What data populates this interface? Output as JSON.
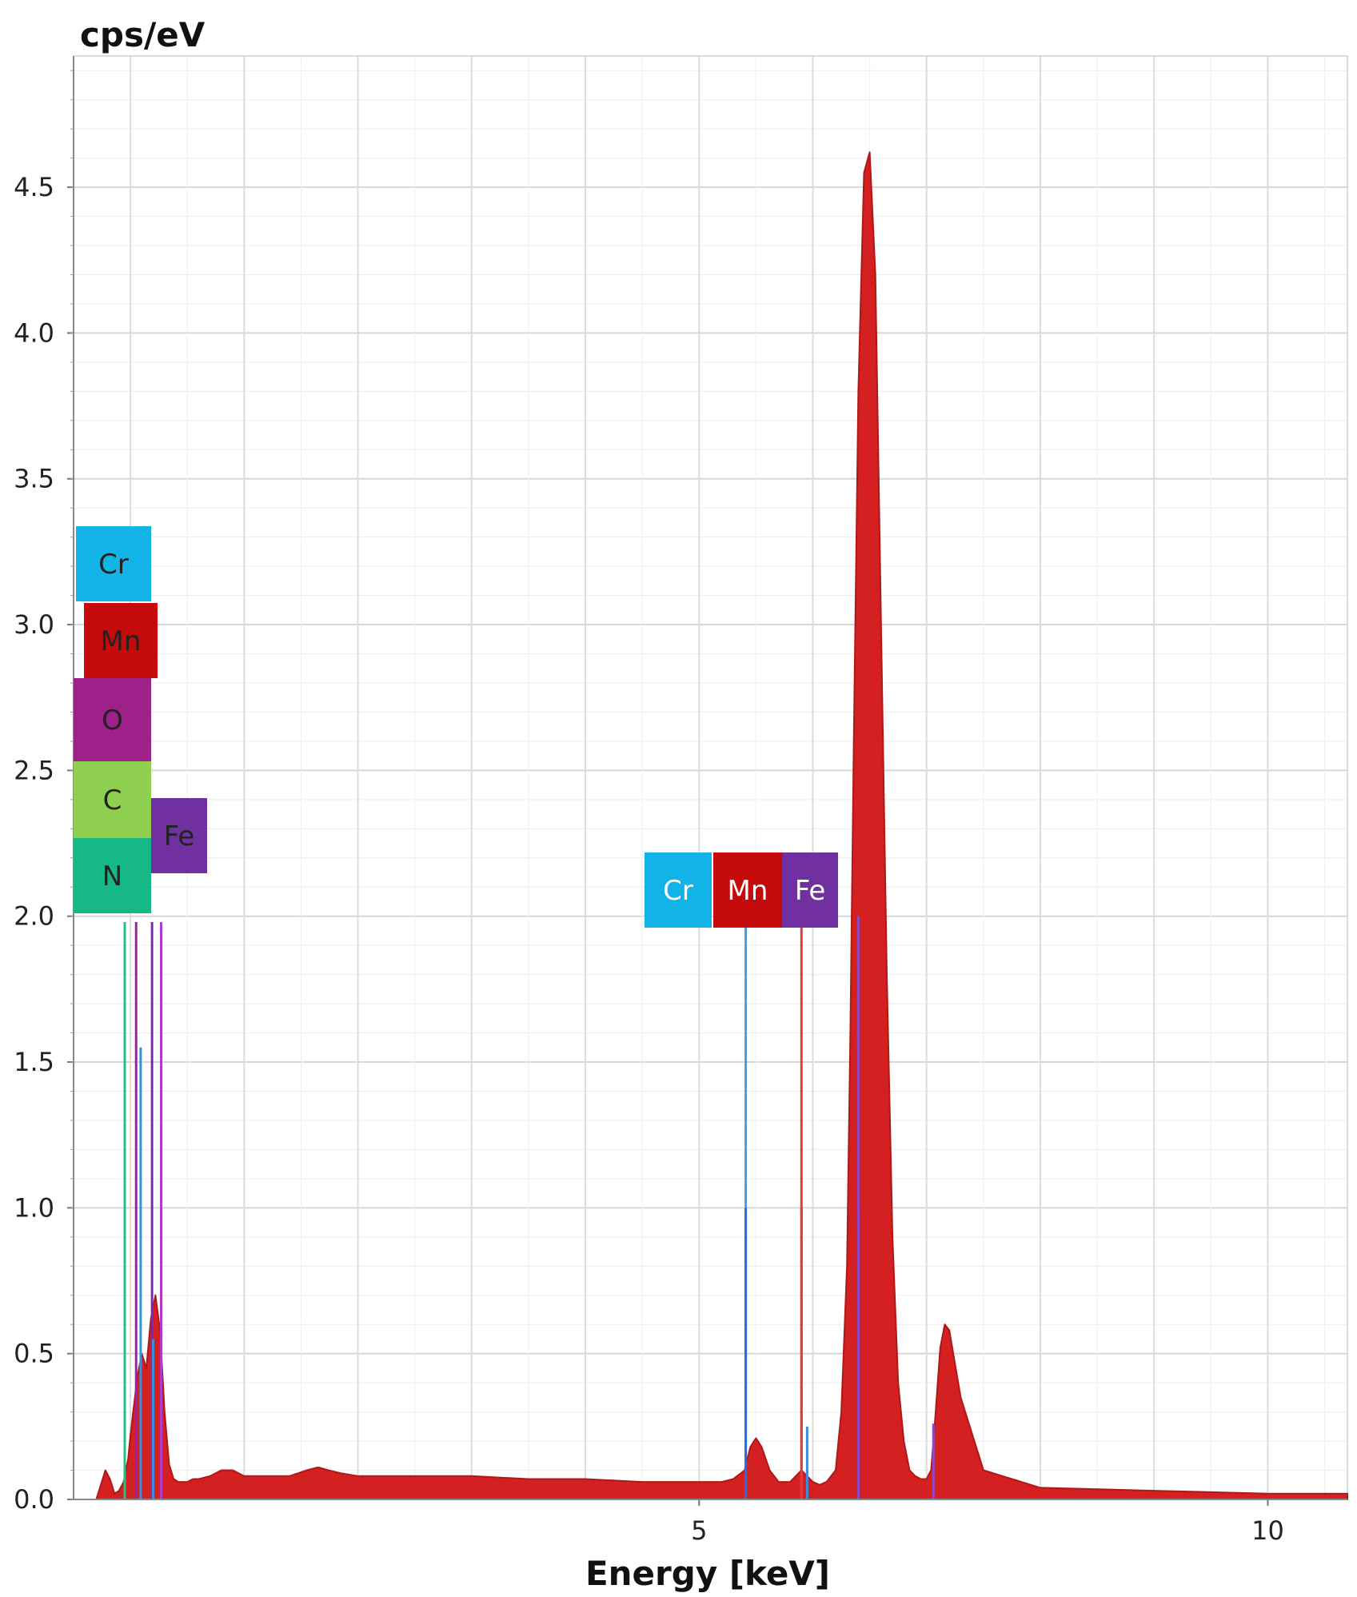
{
  "chart_data": {
    "type": "area",
    "ylabel": "cps/eV",
    "xlabel": "Energy [keV]",
    "xlim": [
      -0.5,
      10.7
    ],
    "ylim": [
      0,
      4.95
    ],
    "x_ticks": [
      {
        "value": 5,
        "label": "5"
      },
      {
        "value": 10,
        "label": "10"
      }
    ],
    "y_ticks": [
      {
        "value": 0.0,
        "label": "0.0"
      },
      {
        "value": 0.5,
        "label": "0.5"
      },
      {
        "value": 1.0,
        "label": "1.0"
      },
      {
        "value": 1.5,
        "label": "1.5"
      },
      {
        "value": 2.0,
        "label": "2.0"
      },
      {
        "value": 2.5,
        "label": "2.5"
      },
      {
        "value": 3.0,
        "label": "3.0"
      },
      {
        "value": 3.5,
        "label": "3.5"
      },
      {
        "value": 4.0,
        "label": "4.0"
      },
      {
        "value": 4.5,
        "label": "4.5"
      }
    ],
    "grid": true,
    "spectrum": {
      "color": "#d42020",
      "x": [
        -0.3,
        -0.26,
        -0.22,
        -0.18,
        -0.14,
        -0.1,
        -0.06,
        -0.02,
        0.0,
        0.06,
        0.1,
        0.14,
        0.18,
        0.22,
        0.26,
        0.3,
        0.34,
        0.38,
        0.42,
        0.46,
        0.5,
        0.55,
        0.6,
        0.7,
        0.8,
        0.9,
        1.0,
        1.2,
        1.4,
        1.55,
        1.65,
        1.74,
        1.85,
        2.0,
        2.5,
        3.0,
        3.5,
        4.0,
        4.5,
        5.0,
        5.2,
        5.3,
        5.4,
        5.45,
        5.5,
        5.55,
        5.62,
        5.7,
        5.8,
        5.9,
        5.95,
        6.0,
        6.06,
        6.12,
        6.2,
        6.25,
        6.3,
        6.33,
        6.36,
        6.4,
        6.45,
        6.5,
        6.55,
        6.6,
        6.65,
        6.7,
        6.75,
        6.8,
        6.85,
        6.9,
        6.95,
        7.0,
        7.04,
        7.08,
        7.12,
        7.16,
        7.2,
        7.3,
        7.5,
        8.0,
        9.0,
        10.0,
        10.7
      ],
      "y": [
        0.0,
        0.05,
        0.1,
        0.07,
        0.02,
        0.03,
        0.06,
        0.14,
        0.22,
        0.42,
        0.5,
        0.45,
        0.62,
        0.7,
        0.58,
        0.3,
        0.12,
        0.07,
        0.06,
        0.06,
        0.06,
        0.07,
        0.07,
        0.08,
        0.1,
        0.1,
        0.08,
        0.08,
        0.08,
        0.1,
        0.11,
        0.1,
        0.09,
        0.08,
        0.08,
        0.08,
        0.07,
        0.07,
        0.06,
        0.06,
        0.06,
        0.07,
        0.1,
        0.18,
        0.21,
        0.18,
        0.1,
        0.06,
        0.06,
        0.1,
        0.08,
        0.06,
        0.05,
        0.06,
        0.1,
        0.3,
        0.8,
        1.6,
        2.6,
        3.8,
        4.55,
        4.62,
        4.2,
        3.0,
        1.8,
        0.9,
        0.4,
        0.2,
        0.1,
        0.08,
        0.07,
        0.07,
        0.1,
        0.3,
        0.52,
        0.6,
        0.58,
        0.35,
        0.1,
        0.04,
        0.03,
        0.02,
        0.02
      ]
    },
    "marker_lines": [
      {
        "x": -0.05,
        "y": 1.98,
        "color": "#22c08a"
      },
      {
        "x": 0.05,
        "y": 1.98,
        "color": "#a020a0"
      },
      {
        "x": 0.09,
        "y": 1.55,
        "color": "#3b8fe0"
      },
      {
        "x": 0.19,
        "y": 1.98,
        "color": "#7a2ab0"
      },
      {
        "x": 0.27,
        "y": 1.98,
        "color": "#b03ad0"
      },
      {
        "x": 0.2,
        "y": 0.55,
        "color": "#3b8fe0"
      },
      {
        "x": 5.41,
        "y": 2.0,
        "color": "#3aa0f0"
      },
      {
        "x": 5.41,
        "y": 1.0,
        "color": "#1e70e0"
      },
      {
        "x": 5.9,
        "y": 2.0,
        "color": "#e03a3a"
      },
      {
        "x": 5.9,
        "y": 1.0,
        "color": "#e03a3a"
      },
      {
        "x": 5.95,
        "y": 0.25,
        "color": "#3b8fe0"
      },
      {
        "x": 6.4,
        "y": 2.0,
        "color": "#8a4ad0"
      },
      {
        "x": 6.4,
        "y": 1.0,
        "color": "#8a4ad0"
      },
      {
        "x": 7.06,
        "y": 0.26,
        "color": "#8a4ad0"
      }
    ],
    "element_tags": [
      {
        "label": "Cr",
        "bg": "#12b4e8",
        "fg": "#222222"
      },
      {
        "label": "Mn",
        "bg": "#c40a0a",
        "fg": "#222222"
      },
      {
        "label": "O",
        "bg": "#a0208a",
        "fg": "#222222"
      },
      {
        "label": "C",
        "bg": "#90d050",
        "fg": "#222222"
      },
      {
        "label": "N",
        "bg": "#16b886",
        "fg": "#222222"
      },
      {
        "label": "Fe",
        "bg": "#7030a0",
        "fg": "#222222"
      },
      {
        "label": "Cr",
        "bg": "#12b4e8",
        "fg": "#ffffff"
      },
      {
        "label": "Mn",
        "bg": "#c40a0a",
        "fg": "#ffffff"
      },
      {
        "label": "Fe",
        "bg": "#7030a0",
        "fg": "#ffffff"
      }
    ]
  }
}
